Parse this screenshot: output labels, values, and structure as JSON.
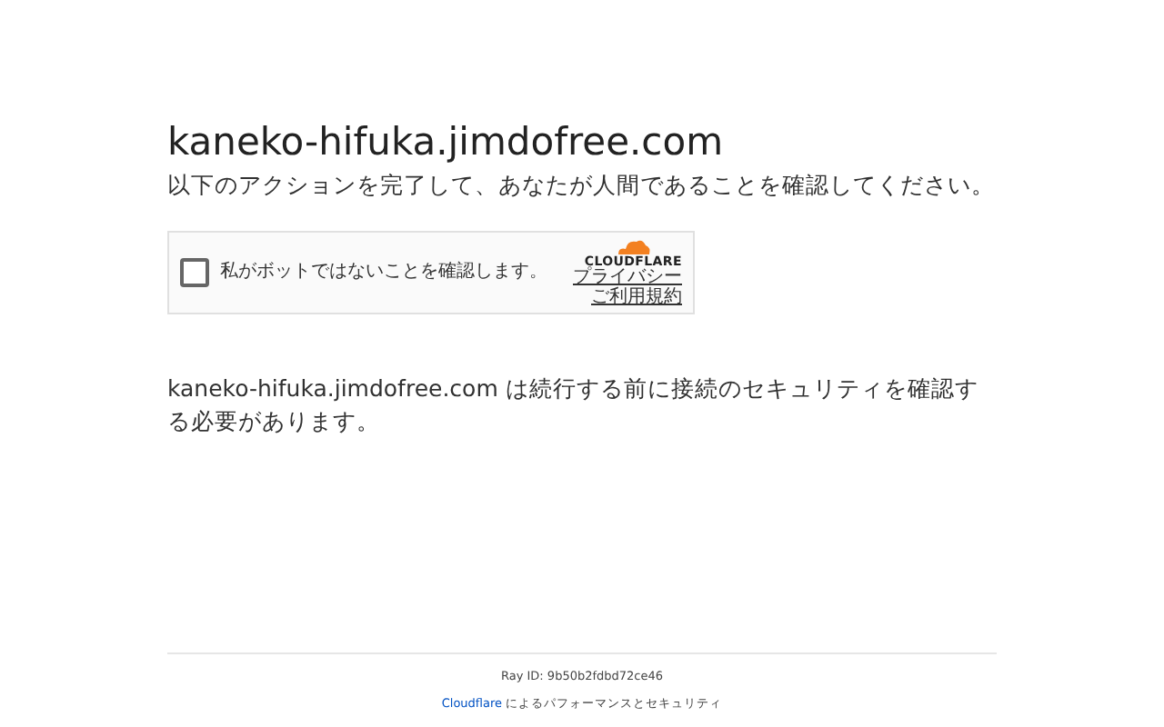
{
  "heading": "kaneko-hifuka.jimdofree.com",
  "subtitle": "以下のアクションを完了して、あなたが人間であることを確認してください。",
  "challenge": {
    "checkbox_label": "私がボットではないことを確認します。",
    "checked": false,
    "logo_text": "CLOUDFLARE",
    "links": [
      "プライバシー",
      "ご利用規約"
    ]
  },
  "message": "kaneko-hifuka.jimdofree.com は続行する前に接続のセキュリティを確認する必要があります。",
  "footer": {
    "ray_id": "Ray ID: 9b50b2fdbd72ce46",
    "link": "Cloudflare",
    "suffix": "によるパフォーマンスとセキュリティ"
  }
}
